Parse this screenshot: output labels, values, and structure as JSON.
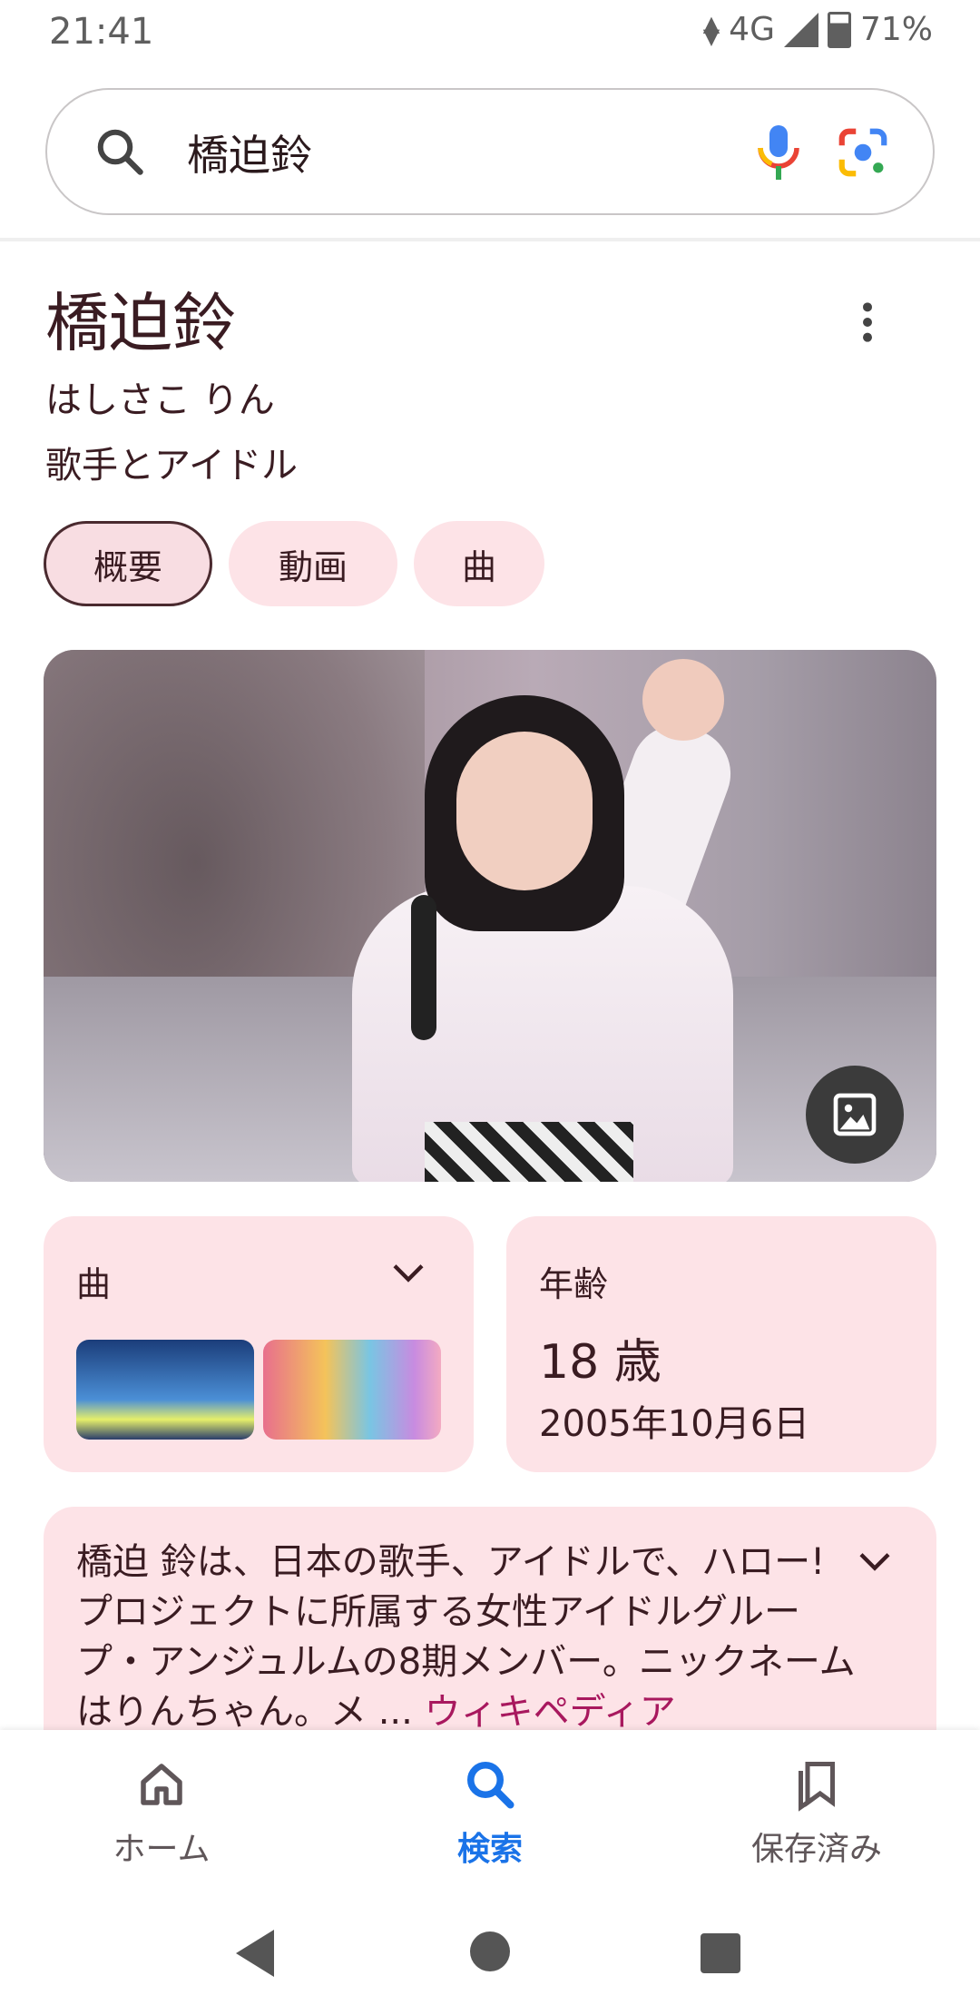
{
  "status_bar": {
    "time": "21:41",
    "network": "4G",
    "battery": "71%"
  },
  "search": {
    "query": "橋迫鈴"
  },
  "entity": {
    "title": "橋迫鈴",
    "reading": "はしさこ りん",
    "description": "歌手とアイドル"
  },
  "tabs": [
    {
      "label": "概要",
      "active": true
    },
    {
      "label": "動画",
      "active": false
    },
    {
      "label": "曲",
      "active": false
    }
  ],
  "songs_card": {
    "label": "曲"
  },
  "age_card": {
    "label": "年齢",
    "age": "18 歳",
    "birth_date": "2005年10月6日"
  },
  "snippet": {
    "text": "橋迫 鈴は、日本の歌手、アイドルで、ハロー!プロジェクトに所属する女性アイドルグループ・アンジュルムの8期メンバー。ニックネームはりんちゃん。メ ...",
    "source": "ウィキペディア"
  },
  "bottom_nav": [
    {
      "label": "ホーム",
      "icon": "home-icon",
      "active": false
    },
    {
      "label": "検索",
      "icon": "search-icon",
      "active": true
    },
    {
      "label": "保存済み",
      "icon": "bookmark-icon",
      "active": false
    }
  ],
  "colors": {
    "accent": "#1a73e8",
    "chip_bg": "#fde3e7",
    "wiki_link": "#a8185e"
  }
}
